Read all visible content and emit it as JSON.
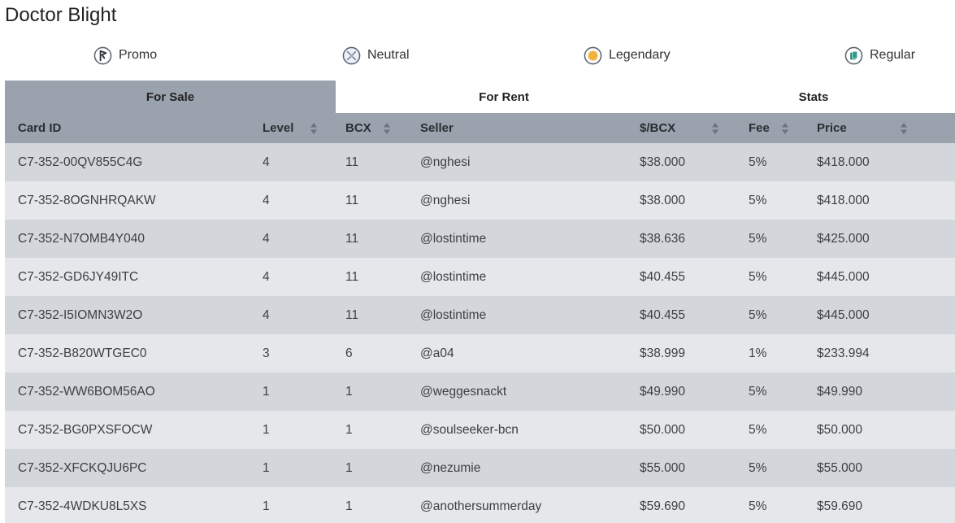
{
  "page": {
    "title": "Doctor Blight"
  },
  "tags": [
    {
      "label": "Promo",
      "icon": "promo-icon"
    },
    {
      "label": "Neutral",
      "icon": "neutral-icon"
    },
    {
      "label": "Legendary",
      "icon": "legendary-icon"
    },
    {
      "label": "Regular",
      "icon": "regular-icon"
    }
  ],
  "tabs": [
    {
      "label": "For Sale",
      "active": true
    },
    {
      "label": "For Rent",
      "active": false
    },
    {
      "label": "Stats",
      "active": false
    }
  ],
  "table": {
    "columns": [
      "Card ID",
      "Level",
      "BCX",
      "Seller",
      "$/BCX",
      "Fee",
      "Price"
    ],
    "sortable": [
      false,
      true,
      true,
      false,
      true,
      true,
      true
    ],
    "rows": [
      [
        "C7-352-00QV855C4G",
        "4",
        "11",
        "@nghesi",
        "$38.000",
        "5%",
        "$418.000"
      ],
      [
        "C7-352-8OGNHRQAKW",
        "4",
        "11",
        "@nghesi",
        "$38.000",
        "5%",
        "$418.000"
      ],
      [
        "C7-352-N7OMB4Y040",
        "4",
        "11",
        "@lostintime",
        "$38.636",
        "5%",
        "$425.000"
      ],
      [
        "C7-352-GD6JY49ITC",
        "4",
        "11",
        "@lostintime",
        "$40.455",
        "5%",
        "$445.000"
      ],
      [
        "C7-352-I5IOMN3W2O",
        "4",
        "11",
        "@lostintime",
        "$40.455",
        "5%",
        "$445.000"
      ],
      [
        "C7-352-B820WTGEC0",
        "3",
        "6",
        "@a04",
        "$38.999",
        "1%",
        "$233.994"
      ],
      [
        "C7-352-WW6BOM56AO",
        "1",
        "1",
        "@weggesnackt",
        "$49.990",
        "5%",
        "$49.990"
      ],
      [
        "C7-352-BG0PXSFOCW",
        "1",
        "1",
        "@soulseeker-bcn",
        "$50.000",
        "5%",
        "$50.000"
      ],
      [
        "C7-352-XFCKQJU6PC",
        "1",
        "1",
        "@nezumie",
        "$55.000",
        "5%",
        "$55.000"
      ],
      [
        "C7-352-4WDKU8L5XS",
        "1",
        "1",
        "@anothersummerday",
        "$59.690",
        "5%",
        "$59.690"
      ]
    ]
  },
  "colors": {
    "header_bg": "#9aa2ad",
    "row_odd": "#d3d6db",
    "row_even": "#e6e7ea",
    "legendary": "#f2b33d",
    "regular": "#2a9d8f"
  }
}
